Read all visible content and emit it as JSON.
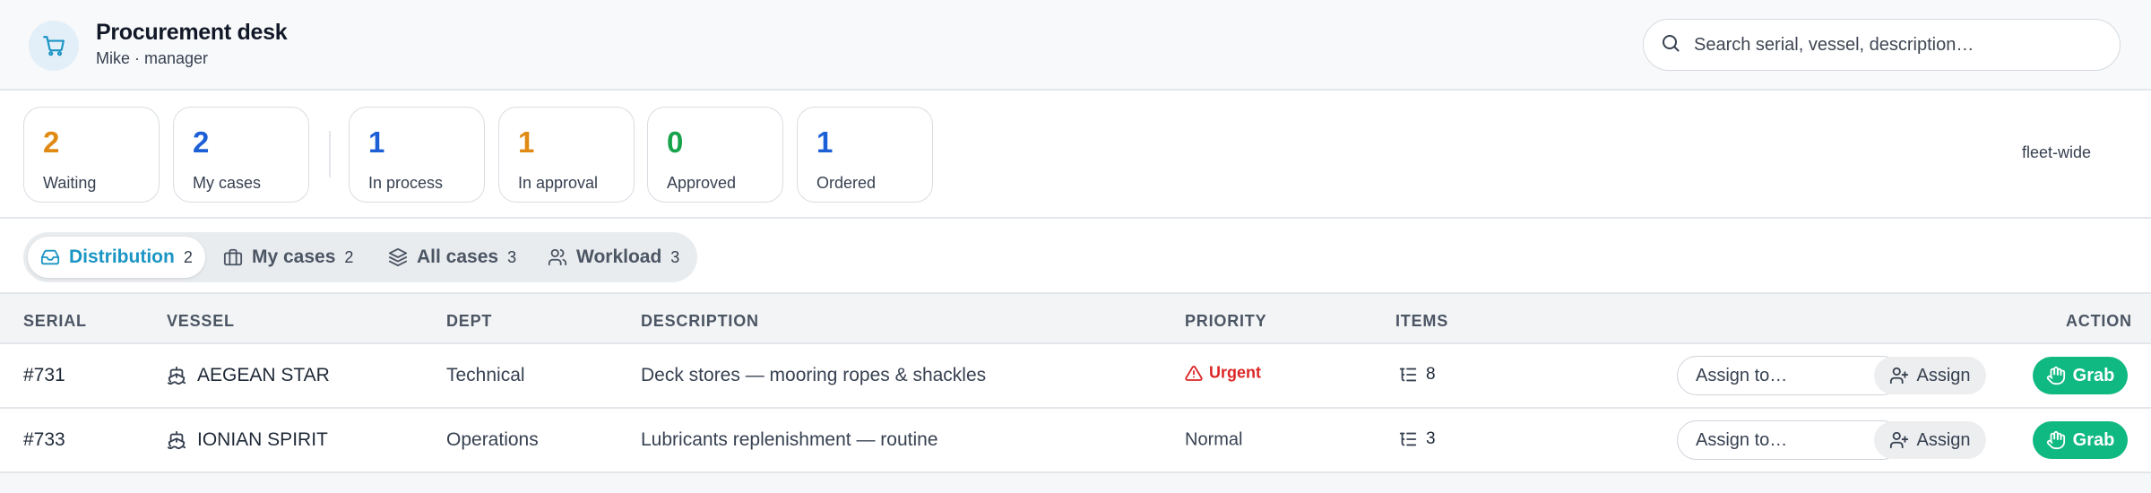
{
  "header": {
    "title": "Procurement desk",
    "subtitle": "Mike · manager",
    "logo_icon": "shopping-cart-icon",
    "search": {
      "placeholder": "Search serial, vessel, description…",
      "value": ""
    }
  },
  "stats": [
    {
      "value": "2",
      "label": "Waiting",
      "color": "#e08a14"
    },
    {
      "value": "2",
      "label": "My cases",
      "color": "#1d5fd6"
    },
    {
      "value": "1",
      "label": "In process",
      "color": "#1d5fd6"
    },
    {
      "value": "1",
      "label": "In approval",
      "color": "#e08a14"
    },
    {
      "value": "0",
      "label": "Approved",
      "color": "#16a34a"
    },
    {
      "value": "1",
      "label": "Ordered",
      "color": "#1d5fd6"
    }
  ],
  "scope_label": "fleet-wide",
  "tabs": [
    {
      "label": "Distribution",
      "count": "2",
      "icon": "inbox-icon",
      "active": true
    },
    {
      "label": "My cases",
      "count": "2",
      "icon": "briefcase-icon",
      "active": false
    },
    {
      "label": "All cases",
      "count": "3",
      "icon": "layers-icon",
      "active": false
    },
    {
      "label": "Workload",
      "count": "3",
      "icon": "users-icon",
      "active": false
    }
  ],
  "table": {
    "columns": [
      "SERIAL",
      "VESSEL",
      "DEPT",
      "DESCRIPTION",
      "PRIORITY",
      "ITEMS",
      "ACTION"
    ],
    "rows": [
      {
        "serial": "#731",
        "vessel": "AEGEAN STAR",
        "dept": "Technical",
        "description": "Deck stores — mooring ropes & shackles",
        "priority": "Urgent",
        "items": "8",
        "assign_placeholder": "Assign to…",
        "assign_label": "Assign",
        "grab_label": "Grab"
      },
      {
        "serial": "#733",
        "vessel": "IONIAN SPIRIT",
        "dept": "Operations",
        "description": "Lubricants replenishment — routine",
        "priority": "Normal",
        "items": "3",
        "assign_placeholder": "Assign to…",
        "assign_label": "Assign",
        "grab_label": "Grab"
      }
    ]
  },
  "colors": {
    "accent": "#1b95c4",
    "grab": "#10b981",
    "urgent": "#dc2626"
  }
}
